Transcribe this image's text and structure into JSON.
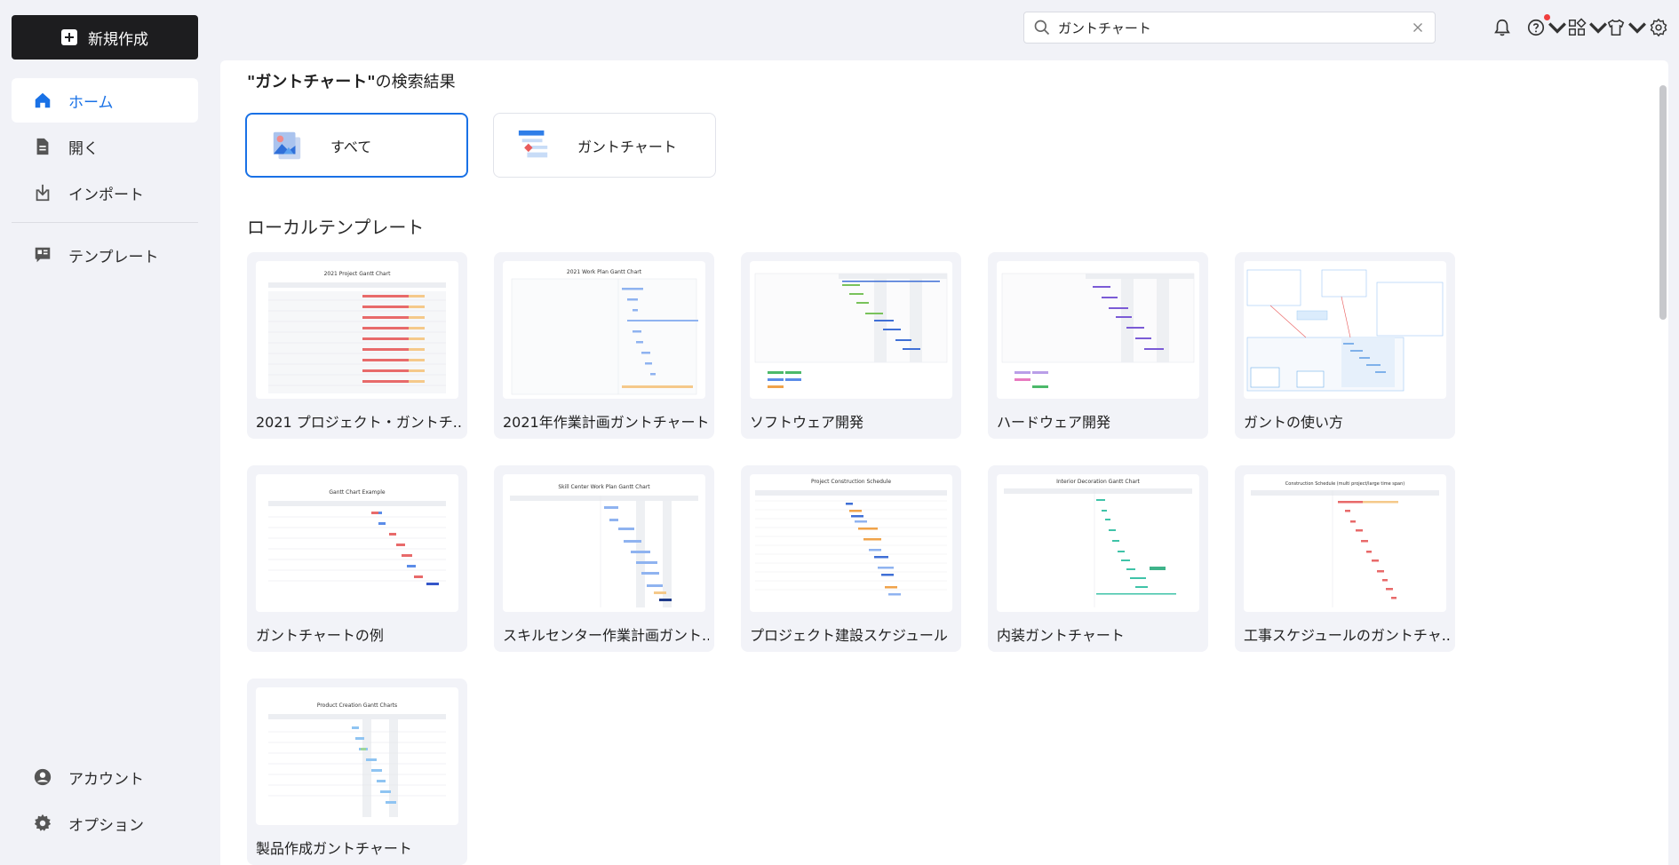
{
  "sidebar": {
    "new_button_label": "新規作成",
    "items": [
      {
        "label": "ホーム",
        "icon": "home-icon"
      },
      {
        "label": "開く",
        "icon": "file-icon"
      },
      {
        "label": "インポート",
        "icon": "import-icon"
      },
      {
        "label": "テンプレート",
        "icon": "template-icon"
      }
    ],
    "bottom_items": [
      {
        "label": "アカウント",
        "icon": "user-icon"
      },
      {
        "label": "オプション",
        "icon": "gear-icon"
      }
    ]
  },
  "search": {
    "value": "ガントチャート",
    "clear_icon": "close-icon"
  },
  "toolbar_icons": [
    "bell-icon",
    "help-icon",
    "apps-icon",
    "shirt-icon",
    "settings-icon"
  ],
  "results": {
    "heading_query": "\"ガントチャート\"",
    "heading_suffix": "の検索結果",
    "filters": [
      {
        "label": "すべて",
        "icon": "images-icon"
      },
      {
        "label": "ガントチャート",
        "icon": "gantt-icon"
      }
    ],
    "section_title": "ローカルテンプレート",
    "templates": [
      {
        "name": "2021 プロジェクト・ガントチ...",
        "thumb_title": "2021 Project Gantt Chart"
      },
      {
        "name": "2021年作業計画ガントチャート",
        "thumb_title": "2021 Work Plan Gantt Chart"
      },
      {
        "name": "ソフトウェア開発",
        "thumb_title": ""
      },
      {
        "name": "ハードウェア開発",
        "thumb_title": ""
      },
      {
        "name": "ガントの使い方",
        "thumb_title": ""
      },
      {
        "name": "ガントチャートの例",
        "thumb_title": "Gantt Chart Example"
      },
      {
        "name": "スキルセンター作業計画ガント...",
        "thumb_title": "Skill Center Work Plan Gantt Chart"
      },
      {
        "name": "プロジェクト建設スケジュール",
        "thumb_title": "Project Construction Schedule"
      },
      {
        "name": "内装ガントチャート",
        "thumb_title": "Interior Decoration Gantt Chart"
      },
      {
        "name": "工事スケジュールのガントチャ...",
        "thumb_title": "Construction Schedule (multi project/large time span)"
      },
      {
        "name": "製品作成ガントチャート",
        "thumb_title": "Product Creation Gantt Charts"
      }
    ]
  },
  "colors": {
    "accent": "#1971e6",
    "gantt_red": "#e86a6a",
    "gantt_blue": "#5b8ce8",
    "gantt_green": "#4cb96a",
    "gantt_purple": "#7b5bd6",
    "gantt_teal": "#3fc3a8",
    "gantt_orange": "#f0a34a"
  }
}
